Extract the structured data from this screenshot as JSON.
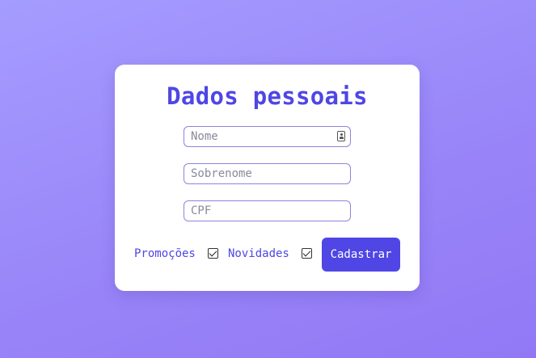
{
  "form": {
    "title": "Dados pessoais",
    "fields": [
      {
        "placeholder": "Nome",
        "value": "",
        "icon": "contact-card-icon"
      },
      {
        "placeholder": "Sobrenome",
        "value": ""
      },
      {
        "placeholder": "CPF",
        "value": ""
      }
    ],
    "options": [
      {
        "label": "Promoções",
        "checked": true
      },
      {
        "label": "Novidades",
        "checked": true
      }
    ],
    "submit_label": "Cadastrar"
  },
  "colors": {
    "accent": "#4f46e5",
    "background_start": "#a59cff",
    "background_end": "#9278f5",
    "field_border": "#8b84e0"
  }
}
